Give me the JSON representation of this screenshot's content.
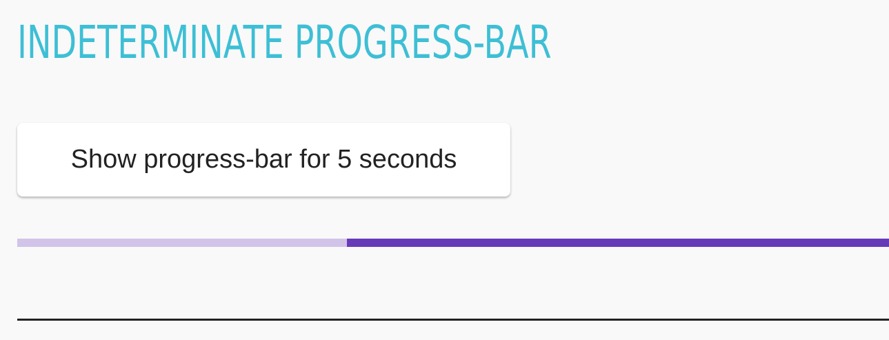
{
  "page": {
    "title": "INDETERMINATE PROGRESS-BAR"
  },
  "actions": {
    "show_button_label": "Show progress-bar for 5 seconds"
  },
  "progress": {
    "mode": "indeterminate",
    "indicator_start_fraction": 0.378,
    "indicator_end_fraction": 1.0
  },
  "colors": {
    "title": "#3dbfd5",
    "progress_track": "#d2c4e8",
    "progress_indicator": "#673ab7",
    "button_background": "#ffffff",
    "button_text": "#222222",
    "background": "#f9f9f9",
    "divider": "#222222"
  }
}
